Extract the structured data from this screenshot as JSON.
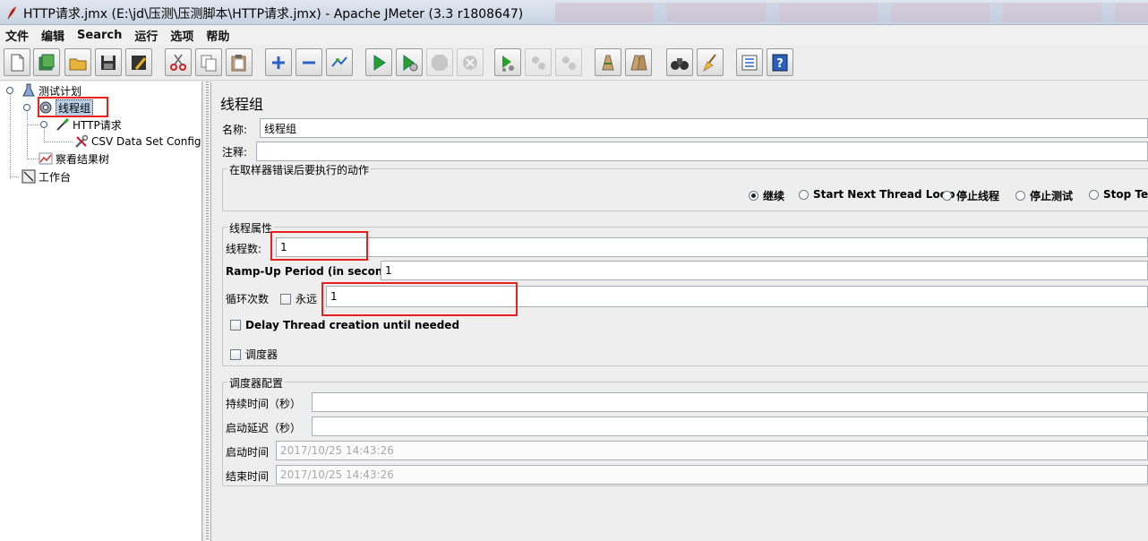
{
  "window": {
    "title": "HTTP请求.jmx (E:\\jd\\压测\\压测脚本\\HTTP请求.jmx) - Apache JMeter (3.3 r1808647)"
  },
  "menu": [
    "文件",
    "编辑",
    "Search",
    "运行",
    "选项",
    "帮助"
  ],
  "toolbar": [
    "new-icon",
    "templates-icon",
    "open-icon",
    "save-icon",
    "save-as-icon",
    "cut-icon",
    "copy-icon",
    "paste-icon",
    "expand-icon",
    "collapse-icon",
    "toggle-icon",
    "start-icon",
    "start-no-timers-icon",
    "stop-icon",
    "shutdown-icon",
    "remote-start-icon",
    "remote-stop-icon",
    "remote-shutdown-icon",
    "clear-icon",
    "clear-all-icon",
    "search-icon",
    "reset-search-icon",
    "function-helper-icon",
    "help-icon"
  ],
  "tree": {
    "test_plan": "测试计划",
    "thread_group": "线程组",
    "http_request": "HTTP请求",
    "csv_config": "CSV Data Set Config",
    "result_tree": "察看结果树",
    "workbench": "工作台"
  },
  "panel": {
    "heading": "线程组",
    "name_label": "名称:",
    "name_value": "线程组",
    "comment_label": "注释:",
    "comment_value": "",
    "error_action": {
      "title": "在取样器错误后要执行的动作",
      "options": [
        "继续",
        "Start Next Thread Loop",
        "停止线程",
        "停止测试",
        "Stop Test Now"
      ],
      "selected": "继续"
    },
    "thread_props": {
      "title": "线程属性",
      "threads_label": "线程数:",
      "threads_value": "1",
      "rampup_label": "Ramp-Up Period (in seconds):",
      "rampup_value": "1",
      "loop_label": "循环次数",
      "forever_label": "永远",
      "loop_value": "1",
      "delay_label": "Delay Thread creation until needed",
      "scheduler_label": "调度器"
    },
    "scheduler": {
      "title": "调度器配置",
      "duration_label": "持续时间（秒）",
      "duration_value": "",
      "delay_label": "启动延迟（秒）",
      "delay_value": "",
      "start_label": "启动时间",
      "start_value": "2017/10/25 14:43:26",
      "end_label": "结束时间",
      "end_value": "2017/10/25 14:43:26"
    }
  }
}
